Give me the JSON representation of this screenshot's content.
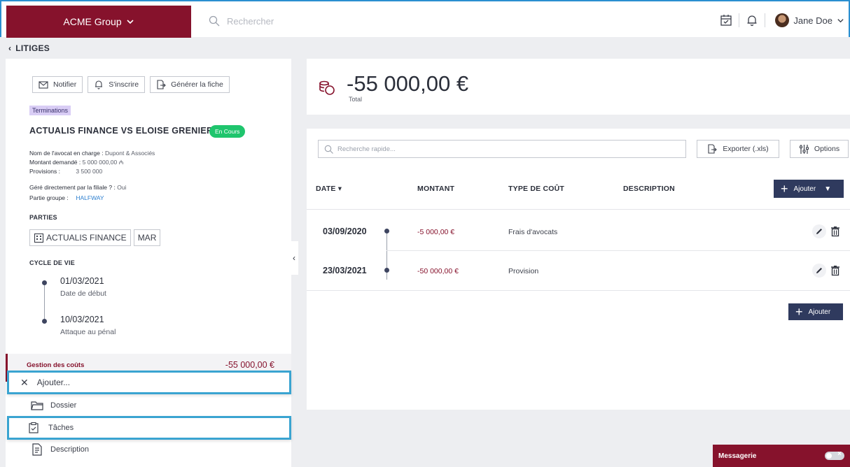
{
  "topbar": {
    "org": "ACME Group",
    "search_placeholder": "Rechercher",
    "user_name": "Jane Doe"
  },
  "breadcrumb": {
    "label": "LITIGES"
  },
  "case": {
    "actions": {
      "notify": "Notifier",
      "subscribe": "S'inscrire",
      "generate": "Générer la fiche"
    },
    "tag": "Terminations",
    "title": "ACTUALIS FINANCE VS ELOISE GRENIER",
    "status": "En Cours",
    "fields": [
      {
        "label": "Nom de l'avocat en charge :",
        "value": "Dupont & Associés"
      },
      {
        "label": "Montant demandé :",
        "value": "5 000 000,00 ₼"
      },
      {
        "label": "Provisions :",
        "value": "3 500 000"
      },
      {
        "label": "Géré directement par la filiale ? :",
        "value": "Oui"
      },
      {
        "label": "Partie groupe :",
        "value": "HALFWAY"
      }
    ],
    "parties_label": "PARTIES",
    "parties": [
      "ACTUALIS FINANCE",
      "MAR"
    ],
    "lifecycle_label": "CYCLE DE VIE",
    "lifecycle": [
      {
        "date": "01/03/2021",
        "label": "Date de début"
      },
      {
        "date": "10/03/2021",
        "label": "Attaque au pénal"
      }
    ],
    "cost_label": "Gestion des coûts",
    "cost_value": "-55 000,00 €"
  },
  "menu": {
    "add": "Ajouter...",
    "dossier": "Dossier",
    "taches": "Tâches",
    "description": "Description"
  },
  "total": {
    "value": "-55 000,00 €",
    "label": "Total"
  },
  "table": {
    "search_placeholder": "Recherche rapide...",
    "export": "Exporter (.xls)",
    "options": "Options",
    "headers": {
      "date": "DATE",
      "amount": "MONTANT",
      "type": "TYPE DE COÛT",
      "description": "DESCRIPTION"
    },
    "add": "Ajouter",
    "rows": [
      {
        "date": "03/09/2020",
        "amount": "-5 000,00 €",
        "type": "Frais d'avocats",
        "description": ""
      },
      {
        "date": "23/03/2021",
        "amount": "-50 000,00 €",
        "type": "Provision",
        "description": ""
      }
    ],
    "add_bottom": "Ajouter"
  },
  "messagerie": {
    "label": "Messagerie"
  }
}
